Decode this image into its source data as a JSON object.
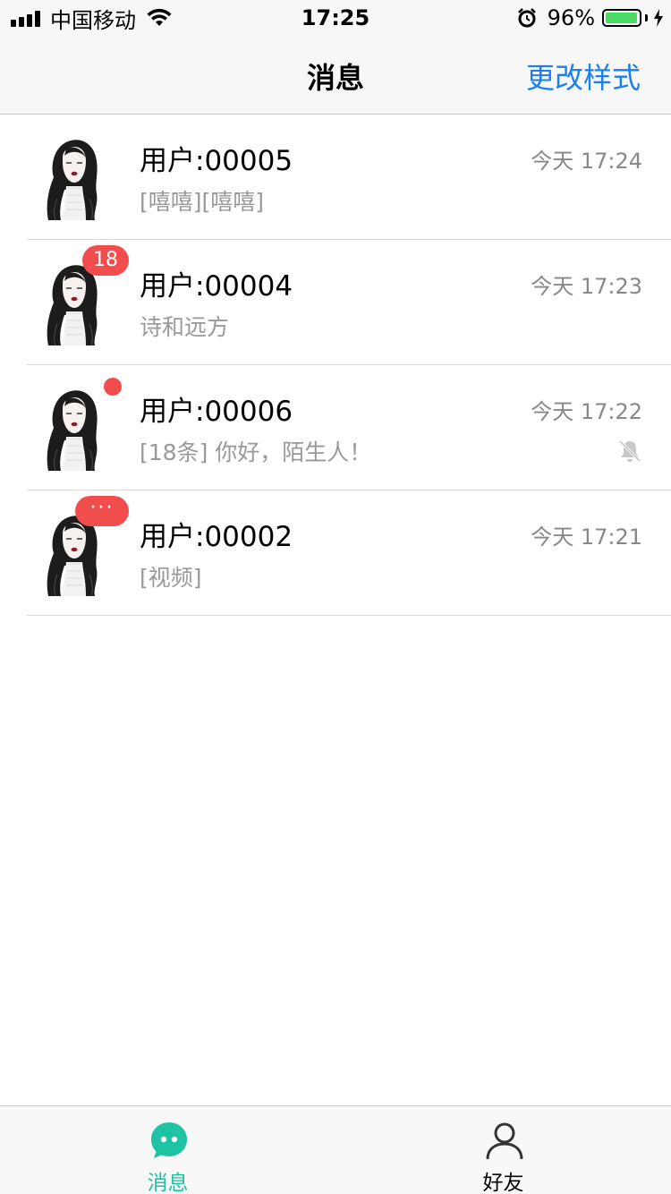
{
  "status_bar": {
    "carrier": "中国移动",
    "time": "17:25",
    "battery_percent": "96%",
    "battery_level": 0.96
  },
  "nav": {
    "title": "消息",
    "action": "更改样式"
  },
  "chats": [
    {
      "name": "用户:00005",
      "time": "今天 17:24",
      "preview": "[嘻嘻][嘻嘻]"
    },
    {
      "name": "用户:00004",
      "time": "今天 17:23",
      "preview": "诗和远方",
      "badge": "18"
    },
    {
      "name": "用户:00006",
      "time": "今天 17:22",
      "preview": "[18条] 你好，陌生人！",
      "muted": true
    },
    {
      "name": "用户:00002",
      "time": "今天 17:21",
      "preview": "[视频]",
      "badge": "···"
    }
  ],
  "tabs": [
    {
      "label": "消息",
      "icon": "chat-bubble-icon",
      "active": true
    },
    {
      "label": "好友",
      "icon": "person-icon",
      "active": false
    }
  ],
  "colors": {
    "accent": "#1a7ff2",
    "badge": "#f24d4d",
    "tab_active": "#1ec3a4",
    "text_secondary": "#999999"
  }
}
